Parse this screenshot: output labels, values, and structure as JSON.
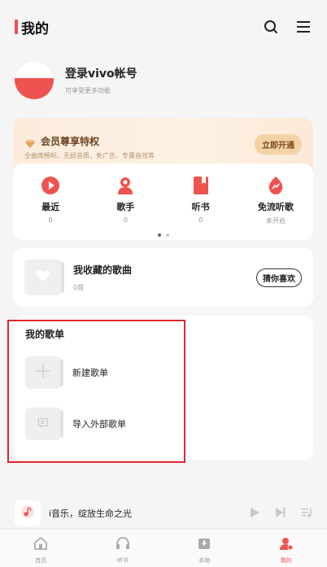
{
  "header": {
    "title": "我的"
  },
  "profile": {
    "login_title": "登录vivo帐号",
    "login_sub": "可享受更多功能"
  },
  "vip": {
    "title": "会员尊享特权",
    "subtitle": "全曲库畅听、无损音质、免广告、专属音效等",
    "button": "立即开通"
  },
  "quick": {
    "items": [
      {
        "label": "最近",
        "sub": "0",
        "icon": "play-icon"
      },
      {
        "label": "歌手",
        "sub": "0",
        "icon": "singer-icon"
      },
      {
        "label": "听书",
        "sub": "0",
        "icon": "book-icon"
      },
      {
        "label": "免流听歌",
        "sub": "未开启",
        "icon": "data-free-icon"
      }
    ],
    "page_count": 2,
    "active_page": 1
  },
  "favorites": {
    "title": "我收藏的歌曲",
    "count": "0首",
    "button": "猜你喜欢"
  },
  "playlists": {
    "header": "我的歌单",
    "items": [
      {
        "label": "新建歌单",
        "icon": "plus-icon"
      },
      {
        "label": "导入外部歌单",
        "icon": "import-icon"
      }
    ]
  },
  "player": {
    "title": "i音乐，绽放生命之光"
  },
  "nav": {
    "items": [
      {
        "label": "首页",
        "icon": "home-icon",
        "active": false
      },
      {
        "label": "听书",
        "icon": "headphones-icon",
        "active": false
      },
      {
        "label": "本地",
        "icon": "local-icon",
        "active": false
      },
      {
        "label": "我的",
        "icon": "user-icon",
        "active": true
      }
    ]
  },
  "colors": {
    "accent": "#ef4f4f",
    "vip_gold": "#f3d3a6",
    "highlight": "#e0272b"
  }
}
